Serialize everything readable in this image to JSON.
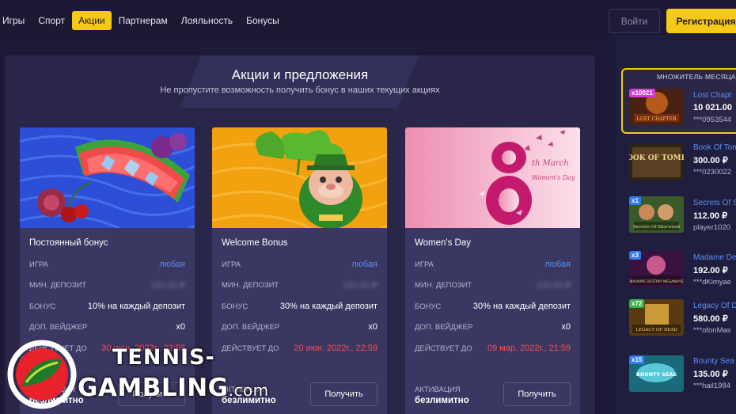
{
  "nav": {
    "items": [
      {
        "label": "Игры",
        "active": false
      },
      {
        "label": "Спорт",
        "active": false
      },
      {
        "label": "Акции",
        "active": true
      },
      {
        "label": "Партнерам",
        "active": false
      },
      {
        "label": "Лояльность",
        "active": false
      },
      {
        "label": "Бонусы",
        "active": false
      }
    ],
    "login_label": "Войти",
    "register_label": "Регистрация"
  },
  "promo": {
    "title": "Акции и предложения",
    "subtitle": "Не пропустите возможность получить бонус в наших текущих акциях",
    "field_labels": {
      "game": "ИГРА",
      "min_deposit": "МИН. ДЕПОЗИТ",
      "bonus": "БОНУС",
      "wager": "ДОП. ВЕЙДЖЕР",
      "valid_until": "ДЕЙСТВУЕТ ДО",
      "activation": "АКТИВАЦИЯ"
    },
    "cards": [
      {
        "name": "Постоянный бонус",
        "game": "любая",
        "min_deposit": "100.00 ₽",
        "bonus": "10% на каждый депозит",
        "wager": "x0",
        "valid_until": "30 июн. 2022г., 22:59",
        "activation": "безлимитно",
        "button": "Получить"
      },
      {
        "name": "Welcome Bonus",
        "game": "любая",
        "min_deposit": "100.00 ₽",
        "bonus": "30% на каждый депозит",
        "wager": "x0",
        "valid_until": "20 июн. 2022г., 22:59",
        "activation": "безлимитно",
        "button": "Получить"
      },
      {
        "name": "Women's Day",
        "game": "любая",
        "min_deposit": "100.00 ₽",
        "bonus": "30% на каждый депозит",
        "wager": "x0",
        "valid_until": "09 мар. 2022г., 21:59",
        "activation": "безлимитно",
        "button": "Получить"
      }
    ],
    "womens_day_art": {
      "digit": "8",
      "caption1": "th March",
      "caption2": "Women's Day"
    }
  },
  "sidebar": {
    "heading": "МНОЖИТЕЛЬ МЕСЯЦА",
    "wins": [
      {
        "multiplier": "x10021",
        "tile_text": "LOST CHAPTER",
        "game": "Lost Chapt",
        "amount": "10 021.00",
        "user": "***0953544"
      },
      {
        "multiplier": "",
        "tile_text": "BOOK OF TOMBS",
        "game": "Book Of Tom",
        "amount": "300.00 ₽",
        "user": "***0230022"
      },
      {
        "multiplier": "x1",
        "tile_text": "Secrets Of Sherwood",
        "game": "Secrets Of S",
        "amount": "112.00 ₽",
        "user": "player1020"
      },
      {
        "multiplier": "x3",
        "tile_text": "MADAME DESTINY MEGAWAYS",
        "game": "Madame De",
        "amount": "192.00 ₽",
        "user": "***dKimyae"
      },
      {
        "multiplier": "x72",
        "tile_text": "LEGACY OF DEAD",
        "game": "Legacy Of D",
        "amount": "580.00 ₽",
        "user": "***ofonMas"
      },
      {
        "multiplier": "x15",
        "tile_text": "BOUNTY SEAS",
        "game": "Bounty Sea",
        "amount": "135.00 ₽",
        "user": "***hail1984"
      }
    ]
  },
  "watermark": {
    "line1": "TENNIS-",
    "line2": "GAMBLING",
    "line2_suffix": ".com"
  },
  "colors": {
    "accent": "#f6c818",
    "link": "#5b8ef0",
    "danger": "#ff4b4b",
    "background": "#1c1a36",
    "card": "#3a3762"
  }
}
